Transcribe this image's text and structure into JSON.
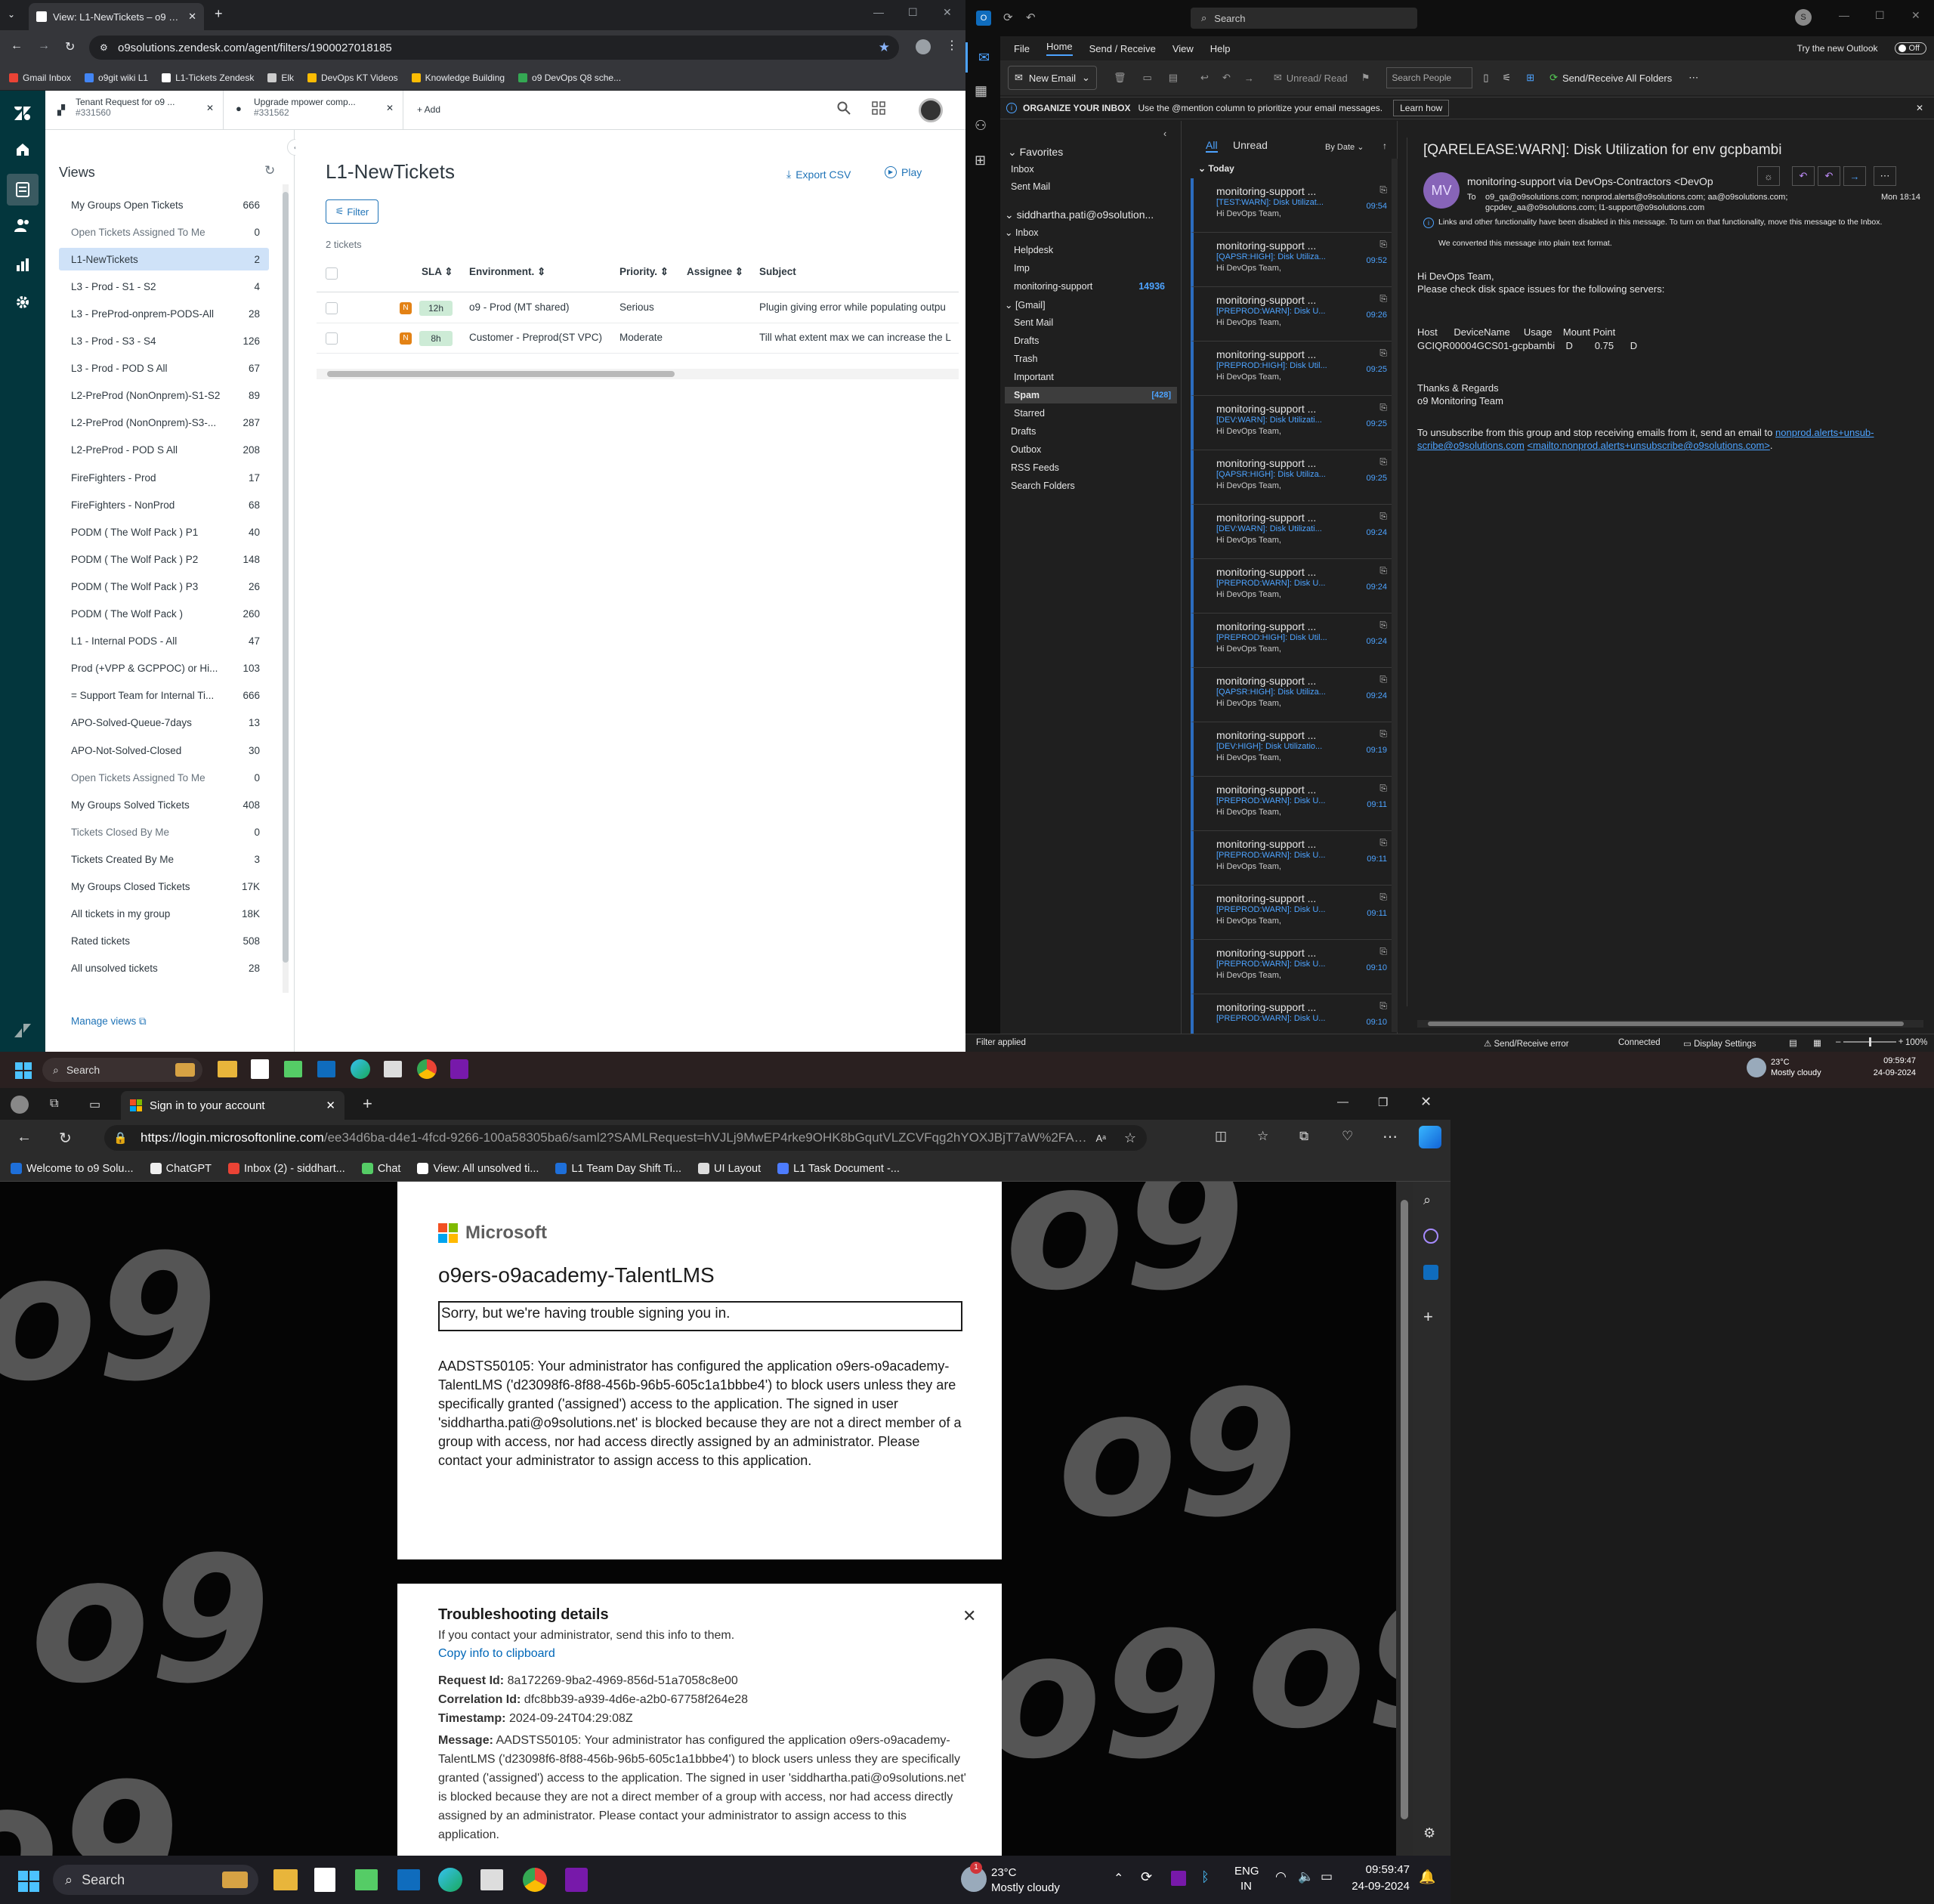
{
  "zendesk": {
    "tab_title": "View: L1-NewTickets – o9 Supp",
    "url": "o9solutions.zendesk.com/agent/filters/1900027018185",
    "bookmarks": [
      {
        "label": "Gmail Inbox",
        "color": "#ea4335"
      },
      {
        "label": "o9git wiki L1",
        "color": "#4285f4"
      },
      {
        "label": "L1-Tickets Zendesk",
        "color": "#ffffff"
      },
      {
        "label": "Elk",
        "color": "#cccccc"
      },
      {
        "label": "DevOps KT Videos",
        "color": "#fbbc04"
      },
      {
        "label": "Knowledge Building",
        "color": "#fbbc04"
      },
      {
        "label": "o9 DevOps Q8 sche...",
        "color": "#34a853"
      }
    ],
    "ticket_tabs": [
      {
        "title": "Tenant Request for o9 ...",
        "id": "#331560"
      },
      {
        "title": "Upgrade mpower comp...",
        "id": "#331562"
      }
    ],
    "add_label": "+ Add",
    "views_title": "Views",
    "views": [
      {
        "label": "My Groups Open Tickets",
        "count": "666",
        "dim": false
      },
      {
        "label": "Open Tickets Assigned To Me",
        "count": "0",
        "dim": true
      },
      {
        "label": "L1-NewTickets",
        "count": "2",
        "dim": false
      },
      {
        "label": "L3 - Prod - S1 - S2",
        "count": "4",
        "dim": false
      },
      {
        "label": "L3 - PreProd-onprem-PODS-All",
        "count": "28",
        "dim": false
      },
      {
        "label": "L3 - Prod - S3 - S4",
        "count": "126",
        "dim": false
      },
      {
        "label": "L3 - Prod - POD S All",
        "count": "67",
        "dim": false
      },
      {
        "label": "L2-PreProd (NonOnprem)-S1-S2",
        "count": "89",
        "dim": false
      },
      {
        "label": "L2-PreProd (NonOnprem)-S3-...",
        "count": "287",
        "dim": false
      },
      {
        "label": "L2-PreProd - POD S All",
        "count": "208",
        "dim": false
      },
      {
        "label": "FireFighters - Prod",
        "count": "17",
        "dim": false
      },
      {
        "label": "FireFighters - NonProd",
        "count": "68",
        "dim": false
      },
      {
        "label": "PODM ( The Wolf Pack ) P1",
        "count": "40",
        "dim": false
      },
      {
        "label": "PODM ( The Wolf Pack ) P2",
        "count": "148",
        "dim": false
      },
      {
        "label": "PODM ( The Wolf Pack ) P3",
        "count": "26",
        "dim": false
      },
      {
        "label": "PODM ( The Wolf Pack )",
        "count": "260",
        "dim": false
      },
      {
        "label": "L1 - Internal PODS - All",
        "count": "47",
        "dim": false
      },
      {
        "label": "Prod (+VPP & GCPPOC) or Hi...",
        "count": "103",
        "dim": false
      },
      {
        "label": "= Support Team for Internal Ti...",
        "count": "666",
        "dim": false
      },
      {
        "label": "APO-Solved-Queue-7days",
        "count": "13",
        "dim": false
      },
      {
        "label": "APO-Not-Solved-Closed",
        "count": "30",
        "dim": false
      },
      {
        "label": "Open Tickets Assigned To Me",
        "count": "0",
        "dim": true
      },
      {
        "label": "My Groups Solved Tickets",
        "count": "408",
        "dim": false
      },
      {
        "label": "Tickets Closed By Me",
        "count": "0",
        "dim": true
      },
      {
        "label": "Tickets Created By Me",
        "count": "3",
        "dim": false
      },
      {
        "label": "My Groups Closed Tickets",
        "count": "17K",
        "dim": false
      },
      {
        "label": "All tickets in my group",
        "count": "18K",
        "dim": false
      },
      {
        "label": "Rated tickets",
        "count": "508",
        "dim": false
      },
      {
        "label": "All unsolved tickets",
        "count": "28",
        "dim": false
      }
    ],
    "manage_views": "Manage views",
    "view_title": "L1-NewTickets",
    "export_csv": "Export CSV",
    "play": "Play",
    "filter": "Filter",
    "ticket_count": "2 tickets",
    "columns": [
      "SLA",
      "Environment.",
      "Priority.",
      "Assignee",
      "Subject"
    ],
    "rows": [
      {
        "status": "N",
        "sla": "12h",
        "environment": "o9 - Prod (MT shared)",
        "priority": "Serious",
        "assignee": "",
        "subject": "Plugin giving error while populating outpu"
      },
      {
        "status": "N",
        "sla": "8h",
        "environment": "Customer - Preprod(ST VPC)",
        "priority": "Moderate",
        "assignee": "",
        "subject": "Till what extent max we can increase the L"
      }
    ]
  },
  "outlook": {
    "search_placeholder": "Search",
    "menu": [
      "File",
      "Home",
      "Send / Receive",
      "View",
      "Help"
    ],
    "try_new": "Try the new Outlook",
    "toggle": "Off",
    "new_email": "New Email",
    "unread_read": "Unread/ Read",
    "search_people": "Search People",
    "send_receive_all": "Send/Receive All Folders",
    "info_bold": "ORGANIZE YOUR INBOX",
    "info_text": "Use the @mention column to prioritize your email messages.",
    "learn_how": "Learn how",
    "favorites": "Favorites",
    "fav_items": [
      "Inbox",
      "Sent Mail"
    ],
    "account": "siddhartha.pati@o9solution...",
    "inbox": "Inbox",
    "inbox_children": [
      {
        "label": "Helpdesk",
        "count": ""
      },
      {
        "label": "Imp",
        "count": ""
      },
      {
        "label": "monitoring-support",
        "count": "14936"
      }
    ],
    "gmail": "[Gmail]",
    "gmail_children": [
      {
        "label": "Sent Mail",
        "count": ""
      },
      {
        "label": "Drafts",
        "count": ""
      },
      {
        "label": "Trash",
        "count": ""
      },
      {
        "label": "Important",
        "count": ""
      },
      {
        "label": "Spam",
        "count": "[428]"
      },
      {
        "label": "Starred",
        "count": ""
      }
    ],
    "other_folders": [
      "Drafts",
      "Outbox",
      "RSS Feeds",
      "Search Folders"
    ],
    "list_all": "All",
    "list_unread": "Unread",
    "sort": "By Date",
    "today": "Today",
    "messages": [
      {
        "from": "monitoring-support ...",
        "subject": "[TEST:WARN]: Disk Utilizat...",
        "snippet": "Hi DevOps Team,",
        "time": "09:54"
      },
      {
        "from": "monitoring-support ...",
        "subject": "[QAPSR:HIGH]: Disk Utiliza...",
        "snippet": "Hi DevOps Team,",
        "time": "09:52"
      },
      {
        "from": "monitoring-support ...",
        "subject": "[PREPROD:WARN]: Disk U...",
        "snippet": "Hi DevOps Team,",
        "time": "09:26"
      },
      {
        "from": "monitoring-support ...",
        "subject": "[PREPROD:HIGH]: Disk Util...",
        "snippet": "Hi DevOps Team,",
        "time": "09:25"
      },
      {
        "from": "monitoring-support ...",
        "subject": "[DEV:WARN]: Disk Utilizati...",
        "snippet": "Hi DevOps Team,",
        "time": "09:25"
      },
      {
        "from": "monitoring-support ...",
        "subject": "[QAPSR:HIGH]: Disk Utiliza...",
        "snippet": "Hi DevOps Team,",
        "time": "09:25"
      },
      {
        "from": "monitoring-support ...",
        "subject": "[DEV:WARN]: Disk Utilizati...",
        "snippet": "Hi DevOps Team,",
        "time": "09:24"
      },
      {
        "from": "monitoring-support ...",
        "subject": "[PREPROD:WARN]: Disk U...",
        "snippet": "Hi DevOps Team,",
        "time": "09:24"
      },
      {
        "from": "monitoring-support ...",
        "subject": "[PREPROD:HIGH]: Disk Util...",
        "snippet": "Hi DevOps Team,",
        "time": "09:24"
      },
      {
        "from": "monitoring-support ...",
        "subject": "[QAPSR:HIGH]: Disk Utiliza...",
        "snippet": "Hi DevOps Team,",
        "time": "09:24"
      },
      {
        "from": "monitoring-support ...",
        "subject": "[DEV:HIGH]: Disk Utilizatio...",
        "snippet": "Hi DevOps Team,",
        "time": "09:19"
      },
      {
        "from": "monitoring-support ...",
        "subject": "[PREPROD:WARN]: Disk U...",
        "snippet": "Hi DevOps Team,",
        "time": "09:11"
      },
      {
        "from": "monitoring-support ...",
        "subject": "[PREPROD:WARN]: Disk U...",
        "snippet": "Hi DevOps Team,",
        "time": "09:11"
      },
      {
        "from": "monitoring-support ...",
        "subject": "[PREPROD:WARN]: Disk U...",
        "snippet": "Hi DevOps Team,",
        "time": "09:11"
      },
      {
        "from": "monitoring-support ...",
        "subject": "[PREPROD:WARN]: Disk U...",
        "snippet": "Hi DevOps Team,",
        "time": "09:10"
      },
      {
        "from": "monitoring-support ...",
        "subject": "[PREPROD:WARN]: Disk U...",
        "snippet": "",
        "time": "09:10"
      }
    ],
    "reading": {
      "subject": "[QARELEASE:WARN]: Disk Utilization for env gcpbambi",
      "avatar": "MV",
      "from": "monitoring-support via DevOps-Contractors <DevOp",
      "to_label": "To",
      "to": "o9_qa@o9solutions.com; nonprod.alerts@o9solutions.com; aa@o9solutions.com;",
      "to2": "gcpdev_aa@o9solutions.com; l1-support@o9solutions.com",
      "date": "Mon 18:14",
      "notice1": "Links and other functionality have been disabled in this message. To turn on that functionality, move this message to the Inbox.",
      "notice2": "We converted this message into plain text format.",
      "greeting": "Hi DevOps Team,",
      "line1": "Please check disk space issues for the following servers:",
      "table_header": "Host      DeviceName     Usage    Mount Point",
      "table_row": "GCIQR00004GCS01-gcpbambi    D        0.75      D",
      "thanks": "Thanks & Regards",
      "team": "o9 Monitoring Team",
      "unsub1": "To unsubscribe from this group and stop receiving emails from it, send an email to",
      "unsub_link1": "nonprod.alerts+unsub-",
      "unsub_link1b": "scribe@o9solutions.com",
      "unsub_link2": "<mailto:nonprod.alerts+unsubscribe@o9solutions.com>",
      "unsub_end": "."
    },
    "status": {
      "filter": "Filter applied",
      "error": "Send/Receive error",
      "connected": "Connected",
      "display": "Display Settings",
      "zoom": "100%"
    }
  },
  "taskbar_top": {
    "search": "Search",
    "weather_temp": "23°C",
    "weather_desc": "Mostly cloudy",
    "time": "09:59:47",
    "date": "24-09-2024"
  },
  "edge": {
    "tab_title": "Sign in to your account",
    "url_host": "https://login.microsoftonline.com",
    "url_path": "/ee34d6ba-d4e1-4fcd-9266-100a58305ba6/saml2?SAMLRequest=hVJLj9MwEP4rke9OHK8bGqutVLZCVFqg2hYOXJBjT7aW%2FAgeB...",
    "favorites": [
      "Welcome to o9 Solu...",
      "ChatGPT",
      "Inbox (2) - siddhart...",
      "Chat",
      "View: All unsolved ti...",
      "L1 Team Day Shift Ti...",
      "UI Layout",
      "L1 Task Document -..."
    ],
    "ms_name": "Microsoft",
    "app_title": "o9ers-o9academy-TalentLMS",
    "error_heading": "Sorry, but we're having trouble signing you in.",
    "error_body": "AADSTS50105: Your administrator has configured the application o9ers-o9academy-TalentLMS ('d23098f6-8f88-456b-96b5-605c1a1bbbe4') to block users unless they are specifically granted ('assigned') access to the application. The signed in user 'siddhartha.pati@o9solutions.net' is blocked because they are not a direct member of a group with access, nor had access directly assigned by an administrator. Please contact your administrator to assign access to this application.",
    "ts_title": "Troubleshooting details",
    "ts_sub": "If you contact your administrator, send this info to them.",
    "copy_link": "Copy info to clipboard",
    "request_label": "Request Id:",
    "request_id": "8a172269-9ba2-4969-856d-51a7058c8e00",
    "corr_label": "Correlation Id:",
    "corr_id": "dfc8bb39-a939-4d6e-a2b0-67758f264e28",
    "time_label": "Timestamp:",
    "timestamp": "2024-09-24T04:29:08Z",
    "msg_label": "Message:",
    "message": "AADSTS50105: Your administrator has configured the application o9ers-o9academy-TalentLMS ('d23098f6-8f88-456b-96b5-605c1a1bbbe4') to block users unless they are specifically granted ('assigned') access to the application. The signed in user 'siddhartha.pati@o9solutions.net' is blocked because they are not a direct member of a group with access, nor had access directly assigned by an administrator. Please contact your administrator to assign access to this application."
  },
  "taskbar_bottom": {
    "search": "Search",
    "weather_temp": "23°C",
    "weather_desc": "Mostly cloudy",
    "lang1": "ENG",
    "lang2": "IN",
    "time": "09:59:47",
    "date": "24-09-2024",
    "weather_badge": "1"
  }
}
